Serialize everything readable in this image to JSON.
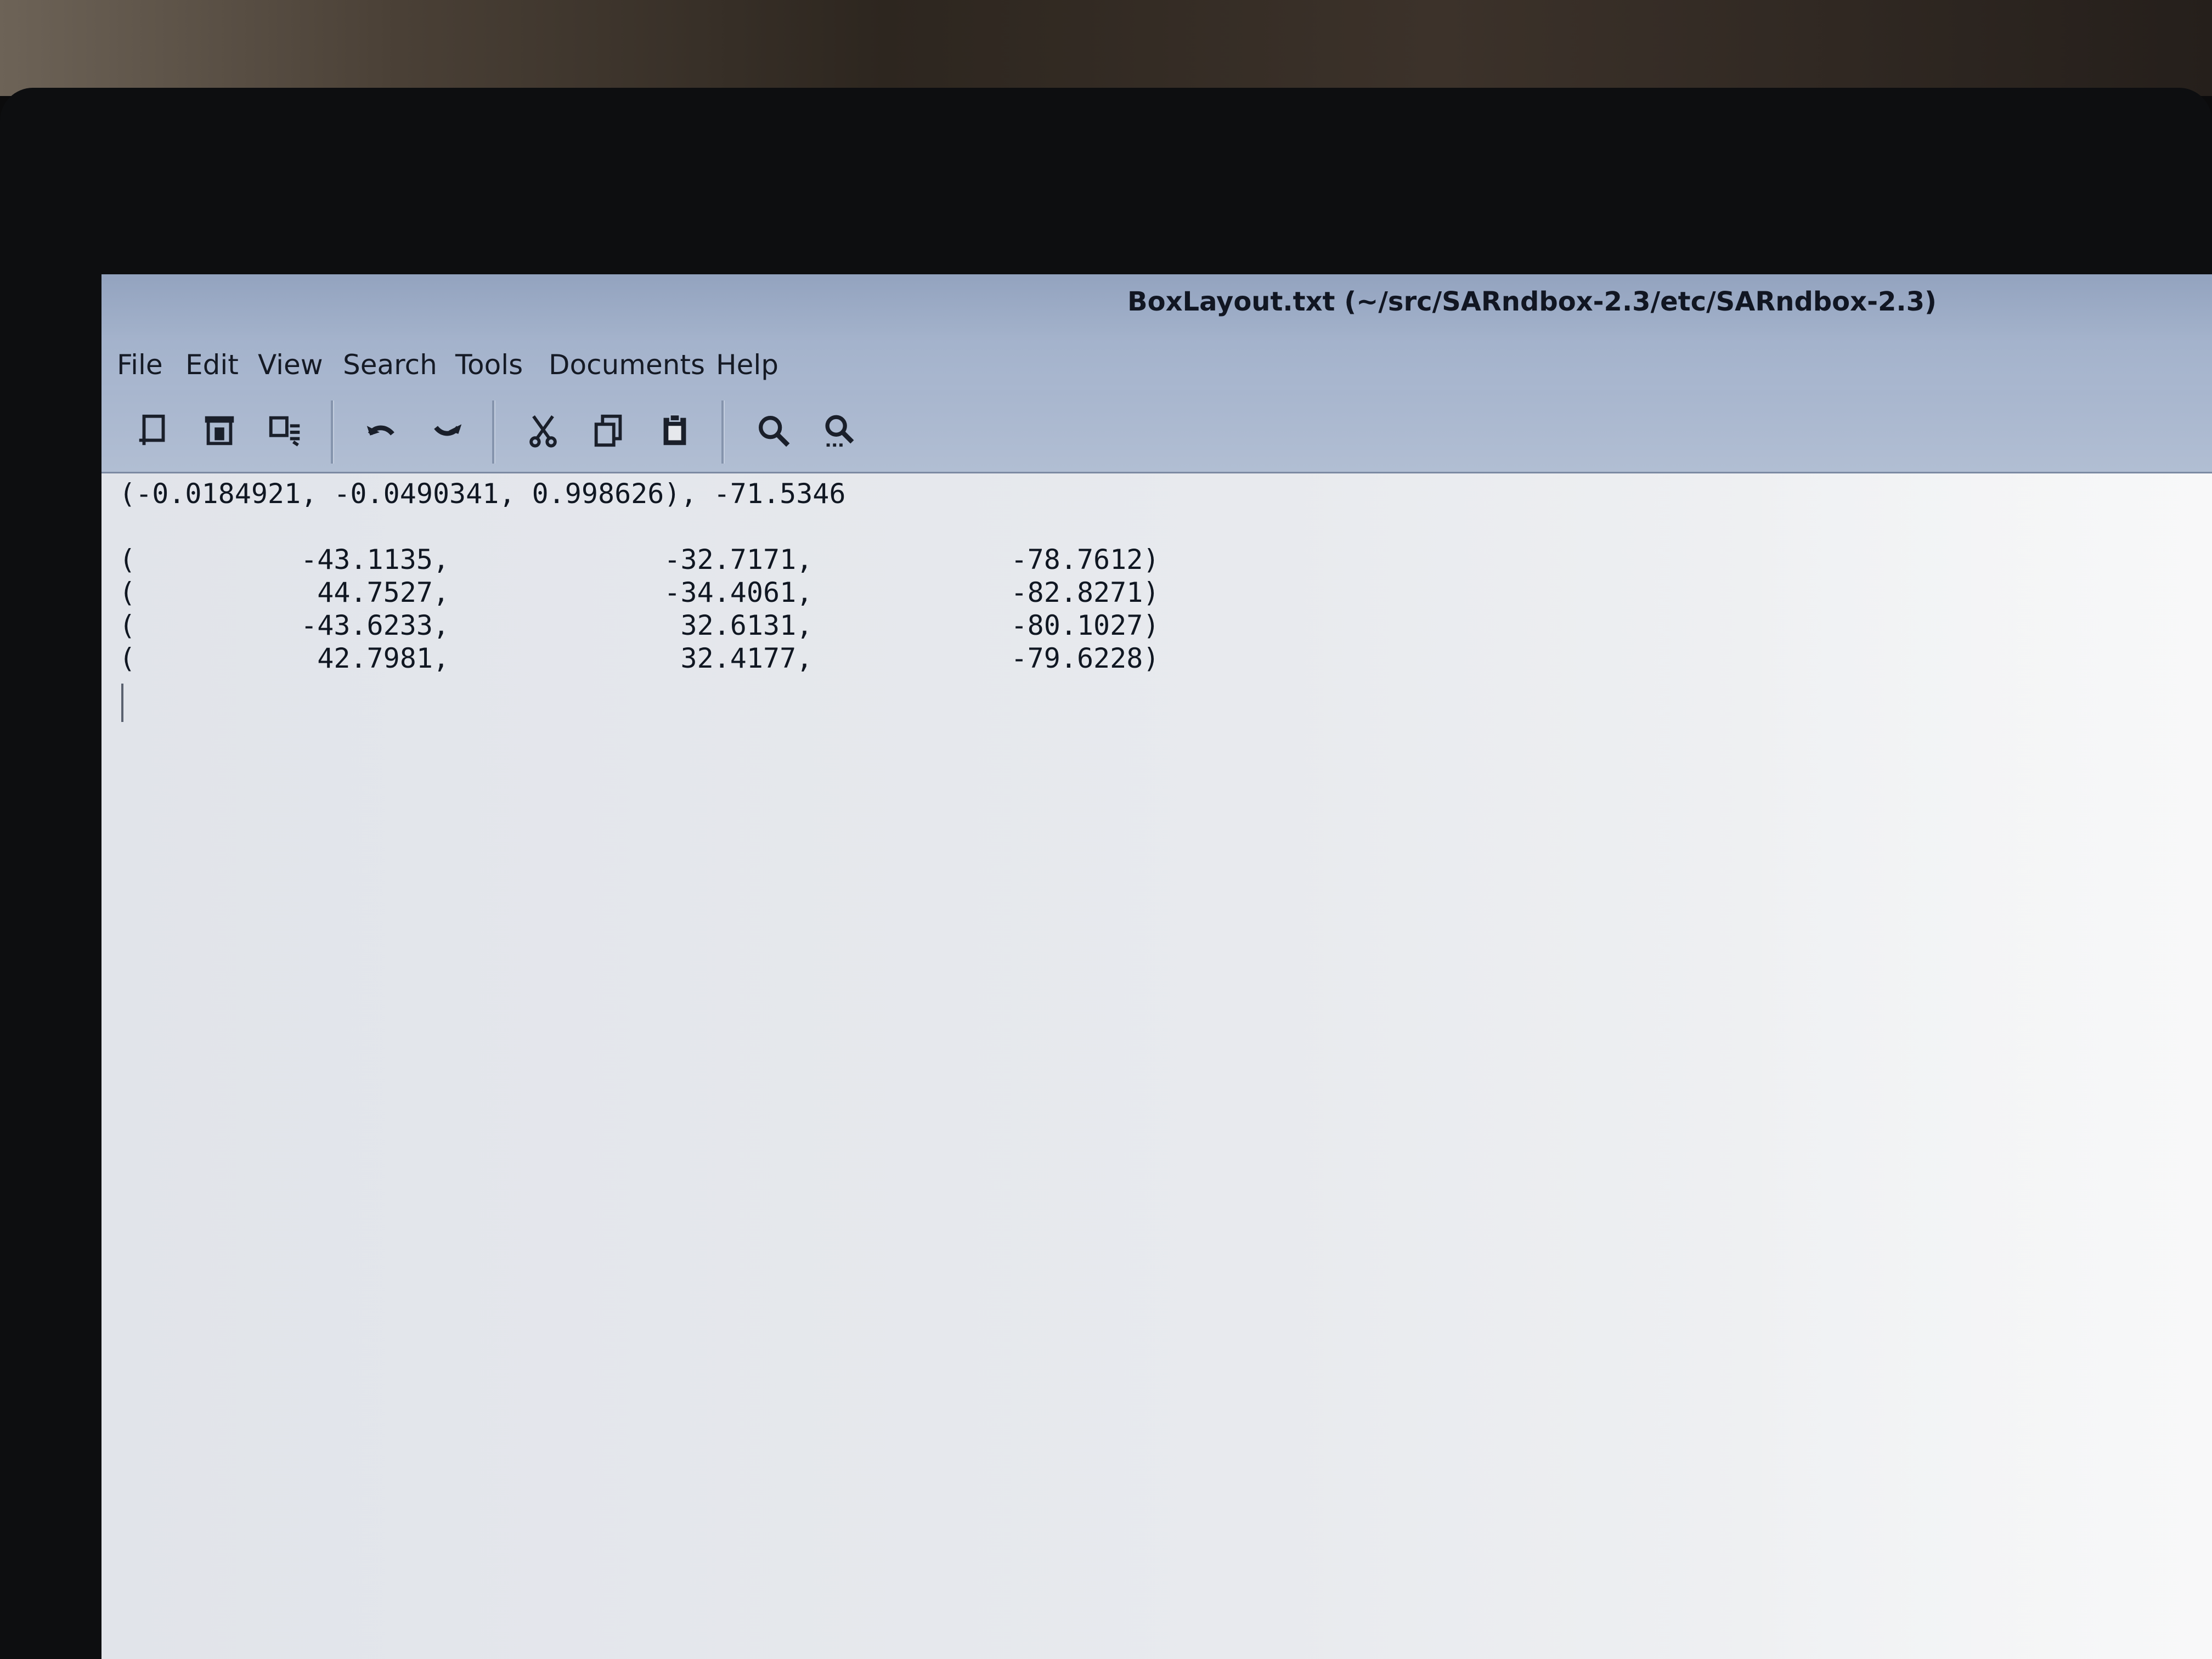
{
  "window": {
    "title": "BoxLayout.txt (~/src/SARndbox-2.3/etc/SARndbox-2.3)"
  },
  "menubar": {
    "items": [
      {
        "label": "File"
      },
      {
        "label": "Edit"
      },
      {
        "label": "View"
      },
      {
        "label": "Search"
      },
      {
        "label": "Tools"
      },
      {
        "label": "Documents"
      },
      {
        "label": "Help"
      }
    ]
  },
  "toolbar": {
    "buttons": [
      {
        "icon": "new-document-icon"
      },
      {
        "icon": "open-document-icon"
      },
      {
        "icon": "save-document-icon"
      },
      {
        "icon": "undo-icon"
      },
      {
        "icon": "redo-icon"
      },
      {
        "icon": "cut-icon"
      },
      {
        "icon": "copy-icon"
      },
      {
        "icon": "paste-icon"
      },
      {
        "icon": "find-icon"
      },
      {
        "icon": "find-replace-icon"
      }
    ]
  },
  "editor": {
    "lines": [
      "(-0.0184921, -0.0490341, 0.998626), -71.5346",
      "",
      "(          -43.1135,             -32.7171,            -78.7612)",
      "(           44.7527,             -34.4061,            -82.8271)",
      "(          -43.6233,              32.6131,            -80.1027)",
      "(           42.7981,              32.4177,            -79.6228)"
    ]
  }
}
